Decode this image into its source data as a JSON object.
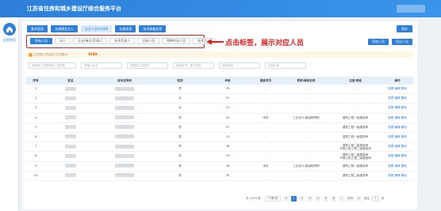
{
  "app_title": "江苏省住房和城乡建设厅综合服务平台",
  "sidebar": {
    "home_label": "回到首页"
  },
  "toolbar": {
    "buttons": [
      "基本信息",
      "本规模业主入",
      "企业人员(1049)",
      "业绩信息",
      "技术装备信息"
    ],
    "action_label": "保存"
  },
  "tabs": [
    "所有人员",
    "法人",
    "企业(单位)负责人",
    "技术负责人",
    "注册人员",
    "特种作业人员",
    "技术工人"
  ],
  "annotation": "点击标签，展示对应人员",
  "right_buttons": [
    "添加人员",
    "导出人员"
  ],
  "notice": {
    "text": "已完成人员认证人员总数计：",
    "count": "1049",
    "unit": "人"
  },
  "filters": [
    "请选择人员类别或人员类型",
    "请输入姓名",
    "请选择人员类别",
    "搜索证书，证书名称",
    "年龄区间",
    "年龄区间"
  ],
  "table": {
    "headers": [
      "序号",
      "姓名",
      "身份证号码",
      "性别",
      "年龄",
      "最高学历",
      "职称/继续名称",
      "注册/资格",
      "操作"
    ],
    "rows": [
      {
        "no": "1",
        "gender": "男",
        "age": "39",
        "edu": "-",
        "title": "-",
        "reg": "-",
        "reg2": "",
        "ops": "查看 编辑 删除"
      },
      {
        "no": "2",
        "gender": "女",
        "age": "37",
        "edu": "-",
        "title": "-",
        "reg": "-",
        "reg2": "",
        "ops": "查看 编辑 删除"
      },
      {
        "no": "3",
        "gender": "女",
        "age": "41",
        "edu": "-",
        "title": "-",
        "reg": "-",
        "reg2": "",
        "ops": "查看 编辑 删除"
      },
      {
        "no": "4",
        "gender": "男",
        "age": "42",
        "edu": "本科",
        "title": "工业设计/高级职称职",
        "reg": "建筑工程一级建造师",
        "reg2": "",
        "ops": "查看 编辑 删除"
      },
      {
        "no": "5",
        "gender": "男",
        "age": "37",
        "edu": "-",
        "title": "-",
        "reg": "建筑工程一级建造师",
        "reg2": "",
        "ops": "查看 编辑 删除"
      },
      {
        "no": "6",
        "gender": "男",
        "age": "33",
        "edu": "-",
        "title": "-",
        "reg": "建筑工程一级建造师",
        "reg2": "",
        "ops": "查看 编辑 删除"
      },
      {
        "no": "7",
        "gender": "男",
        "age": "36",
        "edu": "-",
        "title": "-",
        "reg": "建筑工程二级建造师",
        "reg2": "市政公用工程二级建造师",
        "ops": "查看 编辑 删除"
      },
      {
        "no": "8",
        "gender": "男",
        "age": "33",
        "edu": "-",
        "title": "-",
        "reg": "建筑工程二级建造师",
        "reg2": "市政公用工程二级建造师",
        "ops": "查看 编辑 删除"
      },
      {
        "no": "9",
        "gender": "男",
        "age": "36",
        "edu": "本科",
        "title": "工业设计/高级职称职",
        "reg": "建筑工程一级建造师",
        "reg2": "",
        "ops": "查看 编辑 删除"
      },
      {
        "no": "10",
        "gender": "男",
        "age": "30",
        "edu": "-",
        "title": "-",
        "reg": "建筑工程二级建造师",
        "reg2": "",
        "ops": "查看 编辑 删除"
      }
    ]
  },
  "pagination": {
    "total": "共 1049 条",
    "page_size": "10条/页",
    "pages": [
      "<",
      "1",
      "2",
      "3",
      "4",
      "5",
      "6",
      "…",
      "105",
      ">"
    ],
    "active_page": "1",
    "goto_label": "前往",
    "goto_value": "1",
    "goto_unit": "页"
  },
  "colors": {
    "primary": "#2d7fd8",
    "annotation": "#e02020",
    "notice_bg": "#fdf6e3",
    "count": "#e65c00"
  }
}
